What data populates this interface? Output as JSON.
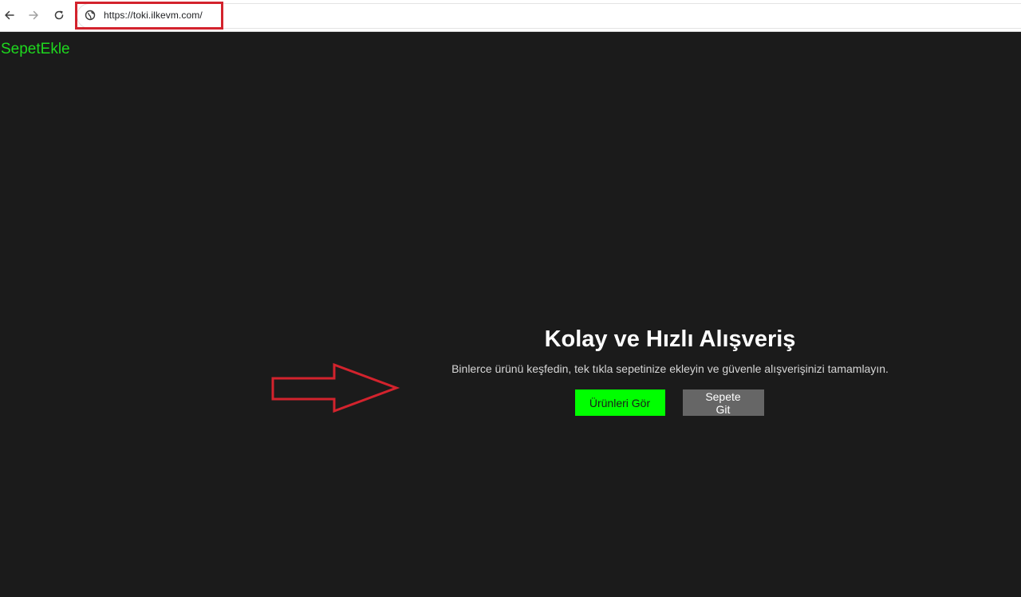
{
  "browser": {
    "url": "https://toki.ilkevm.com/",
    "icons": {
      "back": "arrow-left-icon",
      "forward": "arrow-right-icon",
      "reload": "reload-icon",
      "site": "globe-icon"
    }
  },
  "site": {
    "logo": "SepetEkle"
  },
  "hero": {
    "title": "Kolay ve Hızlı Alışveriş",
    "subtitle": "Binlerce ürünü keşfedin, tek tıkla sepetinize ekleyin ve güvenle alışverişinizi tamamlayın.",
    "primary_button": "Ürünleri Gör",
    "secondary_button": "Sepete Git"
  },
  "colors": {
    "background": "#1b1b1b",
    "accent_green": "#00ff00",
    "logo_green": "#1ed81e",
    "secondary_button": "#666666",
    "annotation_red": "#d3232d"
  }
}
